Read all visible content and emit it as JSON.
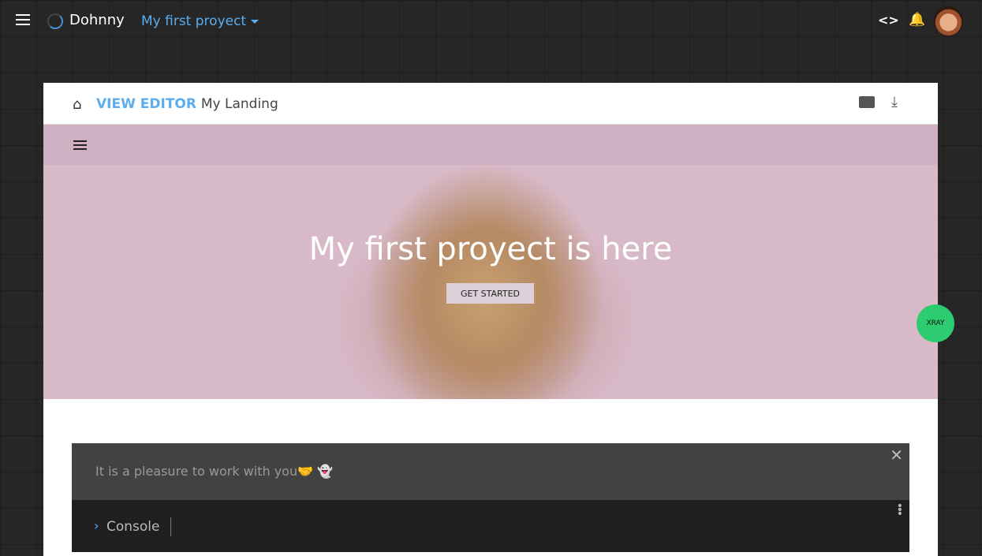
{
  "topbar": {
    "brand": "Dohnny",
    "project": "My first proyect",
    "code_icon": "<>",
    "bell_icon": "🔔"
  },
  "editor": {
    "home_icon": "⌂",
    "mode": "VIEW EDITOR",
    "page_name": "My Landing",
    "download_icon": "⤓"
  },
  "hero": {
    "title": "My first proyect is here",
    "button": "GET STARTED"
  },
  "xray": "XRAY",
  "toast": {
    "message": "It is a pleasure to work with you",
    "emoji": "🤝 👻",
    "close": "✕"
  },
  "console": {
    "chevron": "›",
    "label": "Console",
    "menu": "⋮"
  }
}
